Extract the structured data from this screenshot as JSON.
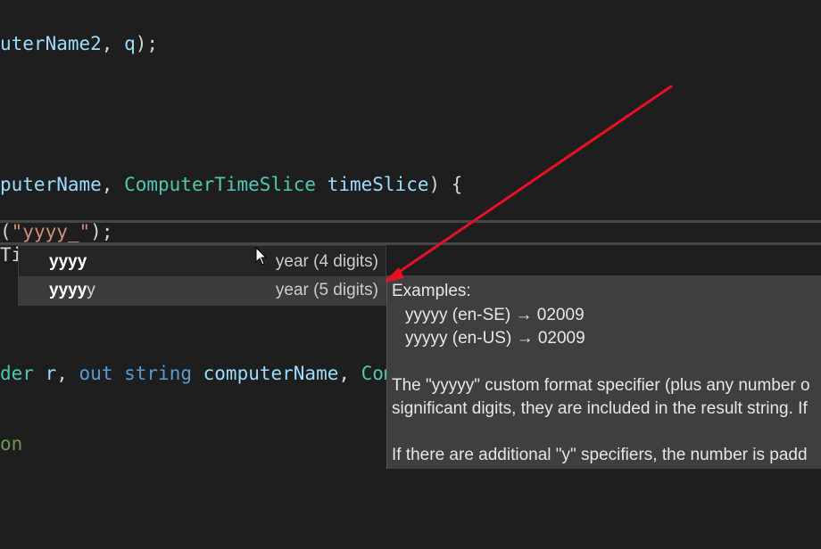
{
  "editor": {
    "line1": {
      "a": "uterName2",
      "b": ", ",
      "c": "q",
      "d": ");"
    },
    "line2": {
      "a": "puterName",
      "b": ", ",
      "c": "ComputerTimeSlice",
      "d": " ",
      "e": "timeSlice",
      "f": ") {"
    },
    "line3": {
      "a": "(",
      "b": "\"yyyy_\"",
      "c": ");"
    },
    "line4": {
      "a": "Ti"
    },
    "line5": {
      "a": "der ",
      "b": "r",
      "c": ", ",
      "d": "out",
      "e": " ",
      "f": "string",
      "g": " ",
      "h": "computerName",
      "i": ", ",
      "j": "Computer"
    },
    "line6": {
      "a": "on"
    }
  },
  "suggest": {
    "items": [
      {
        "label_bold": "yyyy",
        "label_rest": "",
        "detail": "year (4 digits)"
      },
      {
        "label_bold": "yyyy",
        "label_rest": "y",
        "detail": "year (5 digits)"
      }
    ]
  },
  "details": {
    "examples_heading": "Examples:",
    "example1": "yyyyy (en-SE) → 02009",
    "example2": "yyyyy (en-US) → 02009",
    "para1_line1": "The \"yyyyy\" custom format specifier (plus any number o",
    "para1_line2": "significant digits, they are included in the result string. If",
    "para2_line1": "If there are additional \"y\" specifiers, the number is padd"
  },
  "colors": {
    "background": "#1e1e1e",
    "variable": "#9cdcfe",
    "type": "#4ec9b0",
    "keyword": "#569cd6",
    "string": "#ce9178",
    "comment": "#6a9955",
    "annotation_arrow": "#e81123"
  },
  "icons": {
    "cursor": "mouse-pointer-icon",
    "arrow": "annotation-arrow-icon"
  }
}
